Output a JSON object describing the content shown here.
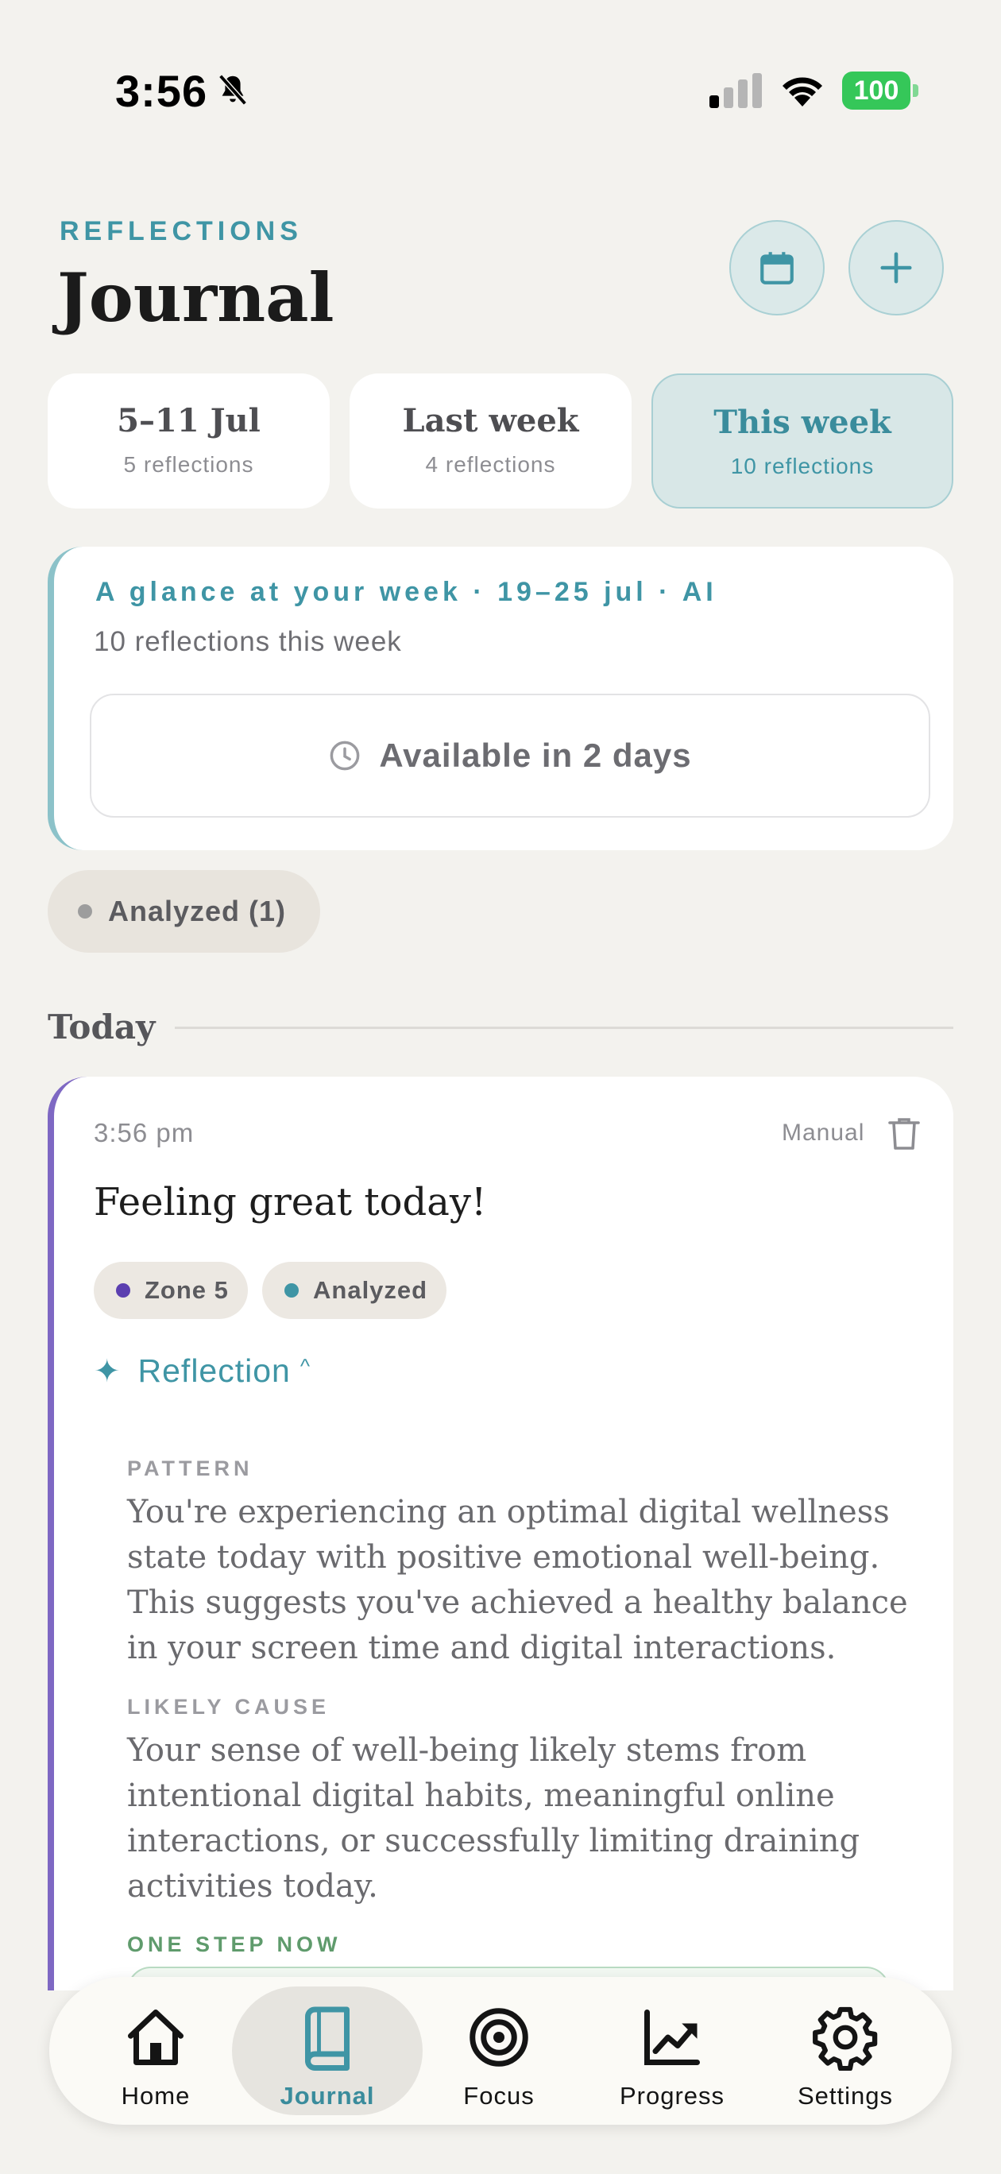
{
  "status_bar": {
    "time": "3:56",
    "battery": "100"
  },
  "header": {
    "eyebrow": "REFLECTIONS",
    "title": "Journal"
  },
  "week_tabs": [
    {
      "label": "5–11 Jul",
      "count": "5 reflections"
    },
    {
      "label": "Last week",
      "count": "4 reflections"
    },
    {
      "label": "This week",
      "count": "10 reflections"
    }
  ],
  "glance": {
    "title": "A glance at your week · 19–25 jul · AI",
    "subtitle": "10 reflections this week",
    "availability": "Available in 2 days"
  },
  "filter": {
    "label": "Analyzed (1)"
  },
  "section": {
    "title": "Today"
  },
  "entry": {
    "time": "3:56 pm",
    "source": "Manual",
    "title": "Feeling great today!",
    "tags": [
      {
        "label": "Zone 5",
        "color": "#5b3fb0"
      },
      {
        "label": "Analyzed",
        "color": "#3f95a5"
      }
    ],
    "reflection_label": "Reflection",
    "pattern_label": "PATTERN",
    "pattern_text": "You're experiencing an optimal digital wellness state today with positive emotional well-being. This suggests you've achieved a healthy balance in your screen time and digital interactions.",
    "cause_label": "LIKELY CAUSE",
    "cause_text": "Your sense of well-being likely stems from intentional digital habits, meaningful online interactions, or successfully limiting draining activities today.",
    "step_label": "ONE STEP NOW"
  },
  "nav": [
    {
      "label": "Home",
      "icon": "home-icon"
    },
    {
      "label": "Journal",
      "icon": "book-icon"
    },
    {
      "label": "Focus",
      "icon": "target-icon"
    },
    {
      "label": "Progress",
      "icon": "chart-icon"
    },
    {
      "label": "Settings",
      "icon": "gear-icon"
    }
  ],
  "colors": {
    "accent": "#3f95a5",
    "entry_border": "#7e68c3",
    "battery": "#35c759"
  }
}
